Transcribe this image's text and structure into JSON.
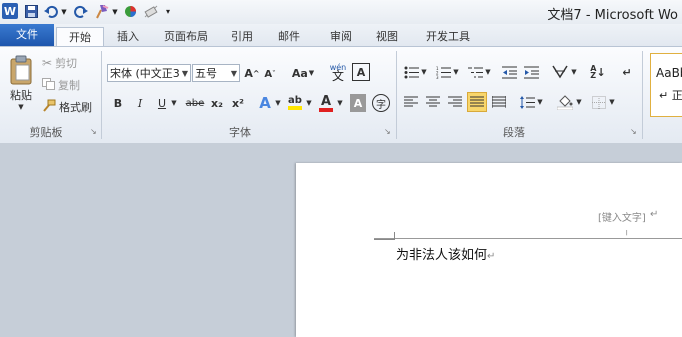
{
  "window": {
    "title": "文档7 - Microsoft Wo",
    "logo_letter": "W"
  },
  "quick_access": {
    "save_icon": "floppy-disk-icon",
    "undo_icon": "undo-icon",
    "redo_icon": "repeat-icon",
    "format_painter_icon": "brush-icon",
    "color_icon": "color-wheel-icon",
    "clear_icon": "eraser-icon",
    "customize_icon": "dropdown-arrow-icon"
  },
  "tabs": [
    "文件",
    "开始",
    "插入",
    "页面布局",
    "引用",
    "邮件",
    "审阅",
    "视图",
    "开发工具"
  ],
  "clipboard": {
    "paste_label": "粘贴",
    "cut_label": "剪切",
    "copy_label": "复制",
    "format_painter_label": "格式刷",
    "group_label": "剪贴板"
  },
  "font": {
    "font_name": "宋体 (中文正3",
    "font_size": "五号",
    "grow_label": "A",
    "shrink_label": "A",
    "case_label": "Aa",
    "phonetic_label": "wén",
    "char_border_label": "A",
    "bold": "B",
    "italic": "I",
    "underline": "U",
    "strike": "abe",
    "subscript": "x₂",
    "superscript": "x²",
    "effects": "A",
    "highlight": "ab",
    "font_color": "A",
    "shading": "A",
    "enclose": "字",
    "group_label": "字体"
  },
  "paragraph": {
    "group_label": "段落"
  },
  "styles": {
    "preview": "AaBb",
    "sub": "↵ 正"
  },
  "document": {
    "header_placeholder": "[键入文字]",
    "body_text": "为非法人该如何",
    "return_mark": "↵"
  },
  "colors": {
    "accent": "#2a5fb3",
    "file_tab": "#1d56ad",
    "highlight": "#ffe600",
    "font_color": "#e02020"
  }
}
